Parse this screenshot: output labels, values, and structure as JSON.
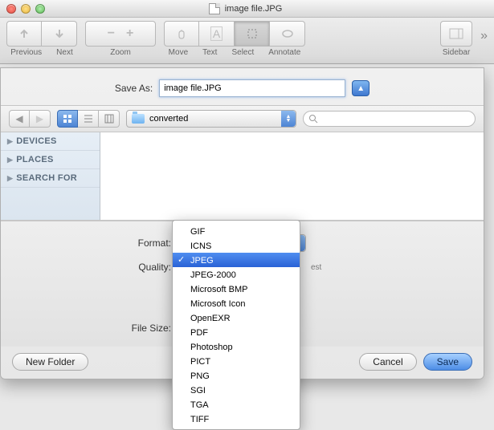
{
  "window": {
    "title": "image file.JPG"
  },
  "toolbar": {
    "previous": "Previous",
    "next": "Next",
    "zoom": "Zoom",
    "move": "Move",
    "text": "Text",
    "select": "Select",
    "annotate": "Annotate",
    "sidebar": "Sidebar"
  },
  "sheet": {
    "saveas_label": "Save As:",
    "saveas_value": "image file.JPG",
    "folder": "converted",
    "search_placeholder": "",
    "sidebar": {
      "items": [
        "DEVICES",
        "PLACES",
        "SEARCH FOR"
      ]
    },
    "format_label": "Format:",
    "quality_label": "Quality:",
    "quality_hint": "est",
    "filesize_label": "File Size:",
    "new_folder": "New Folder",
    "cancel": "Cancel",
    "save": "Save"
  },
  "format_menu": {
    "items": [
      "GIF",
      "ICNS",
      "JPEG",
      "JPEG-2000",
      "Microsoft BMP",
      "Microsoft Icon",
      "OpenEXR",
      "PDF",
      "Photoshop",
      "PICT",
      "PNG",
      "SGI",
      "TGA",
      "TIFF"
    ],
    "selected": "JPEG"
  }
}
